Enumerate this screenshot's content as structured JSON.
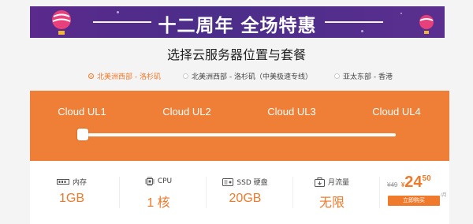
{
  "banner": {
    "title": "十二周年 全场特惠"
  },
  "heading": "选择云服务器位置与套餐",
  "regions": [
    {
      "label": "北美洲西部 - 洛杉矶",
      "active": true
    },
    {
      "label": "北美洲西部 - 洛杉矶（中美极速专线）",
      "active": false
    },
    {
      "label": "亚太东部 - 香港",
      "active": false
    }
  ],
  "plans": [
    "Cloud UL1",
    "Cloud UL2",
    "Cloud UL3",
    "Cloud UL4"
  ],
  "specs": {
    "memory": {
      "label": "内存",
      "value": "1GB"
    },
    "cpu": {
      "label": "CPU",
      "value": "1 核"
    },
    "disk": {
      "label": "SSD 硬盘",
      "value": "20GB"
    },
    "traffic": {
      "label": "月流量",
      "value": "无限"
    }
  },
  "price": {
    "original": "¥49",
    "currency": "¥",
    "integer": "24",
    "decimal": "50",
    "period": "/月",
    "buy_label": "立即购买"
  },
  "colors": {
    "accent": "#ef7a2b",
    "banner": "#4b2d8a"
  }
}
